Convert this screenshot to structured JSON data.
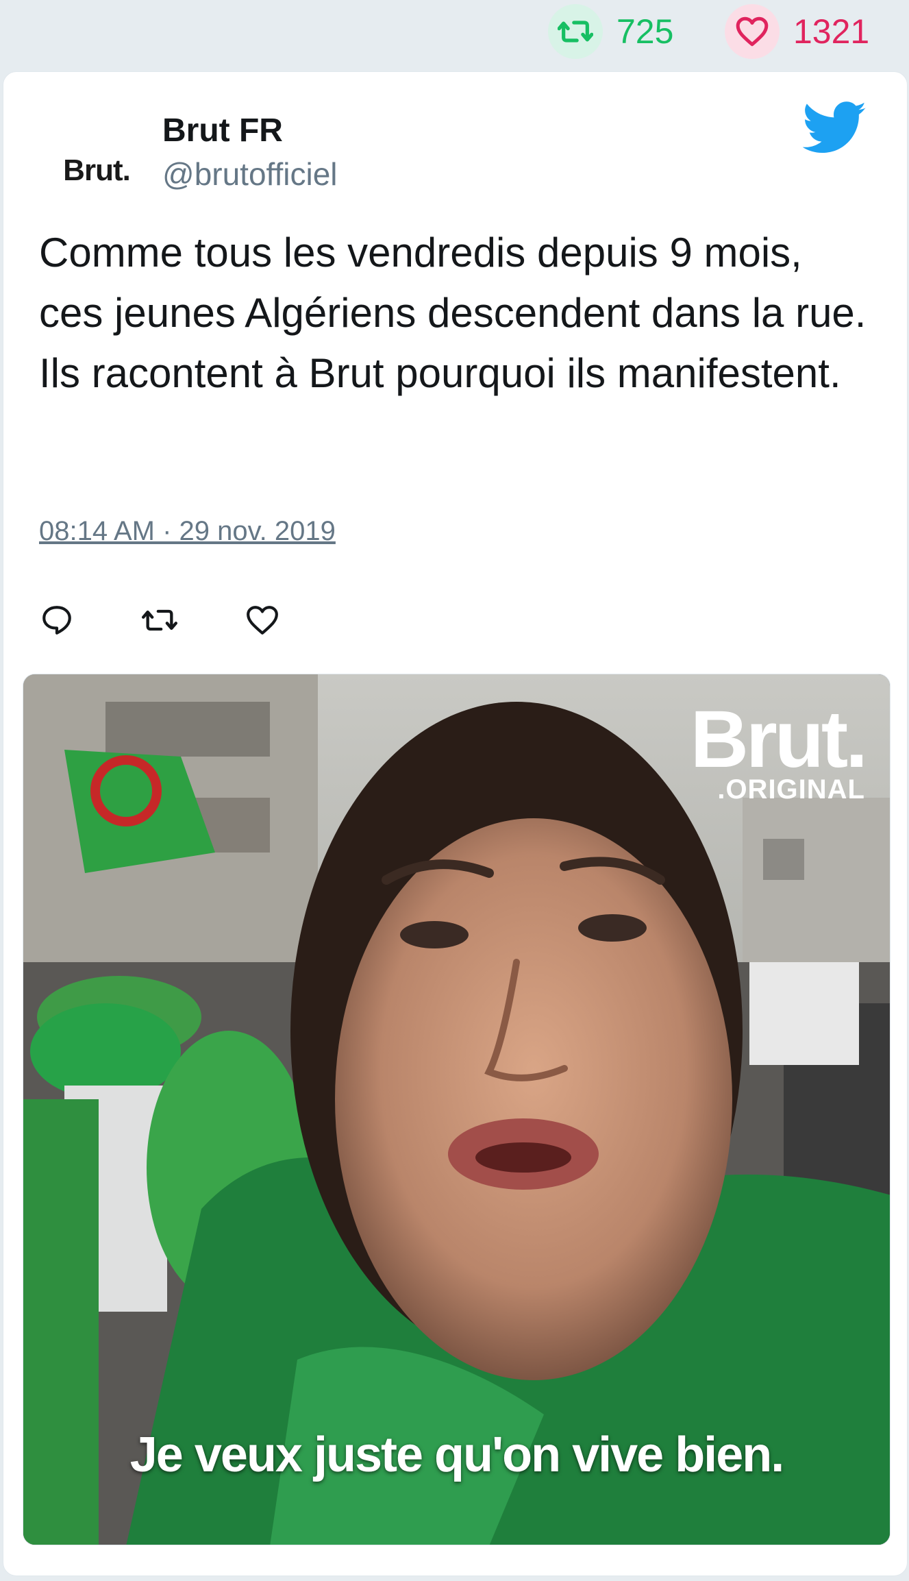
{
  "stats": {
    "retweet_count": "725",
    "like_count": "1321"
  },
  "tweet": {
    "avatar_text": "Brut.",
    "author_name": "Brut FR",
    "author_handle": "@brutofficiel",
    "text": "Comme tous les vendredis depuis 9 mois, ces jeunes Algériens descendent dans la rue. Ils racontent à Brut pourquoi ils manifestent.",
    "timestamp": "08:14 AM · 29 nov. 2019"
  },
  "media": {
    "logo_main": "Brut.",
    "logo_sub": ".ORIGINAL",
    "subtitle": "Je veux juste qu'on vive bien."
  },
  "icons": {
    "retweet": "retweet-icon",
    "like": "heart-icon",
    "reply": "reply-icon",
    "twitter": "twitter-bird-icon"
  },
  "colors": {
    "retweet_green": "#17bf63",
    "like_red": "#e0245e",
    "twitter_blue": "#1da1f2",
    "text_gray": "#657786"
  }
}
